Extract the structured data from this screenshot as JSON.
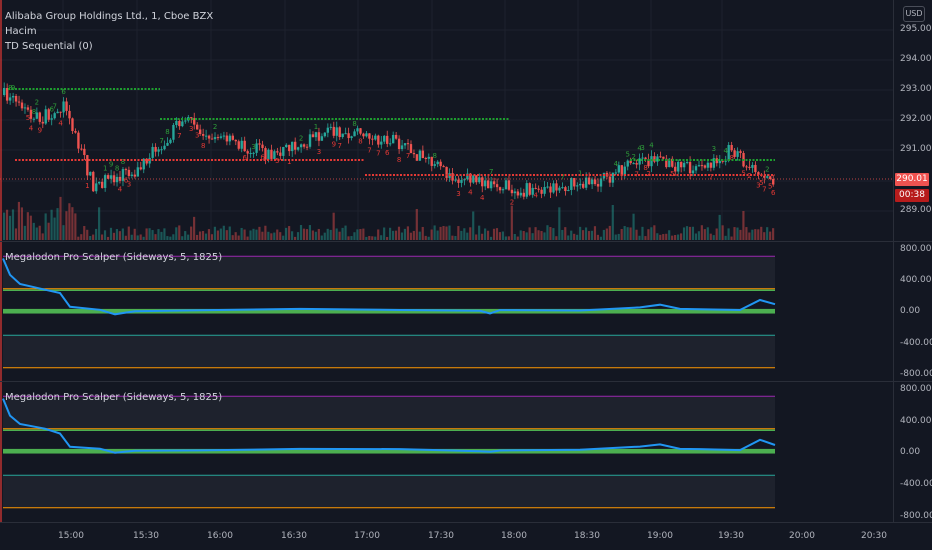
{
  "main": {
    "symbol": "Alibaba Group Holdings Ltd., 1, Cboe BZX",
    "volume_label": "Hacim",
    "indicator_label": "TD Sequential (0)",
    "price_axis": [
      "295.00",
      "294.00",
      "293.00",
      "292.00",
      "291.00",
      "289.00"
    ],
    "last_price": "290.01",
    "countdown": "00:38",
    "currency": "USD",
    "colors": {
      "up": "#26a69a",
      "down": "#ef5350",
      "td_up": "#2e9d3a",
      "td_down": "#e53935",
      "price_badge": "#ef5350",
      "countdown_badge": "#b71c1c"
    }
  },
  "panes": [
    {
      "title": "Megalodon Pro Scalper (Sideways, 5, 1825)",
      "axis": [
        "800.00",
        "400.00",
        "0.00",
        "-400.00",
        "-800.00"
      ]
    },
    {
      "title": "Megalodon Pro Scalper (Sideways, 5, 1825)",
      "axis": [
        "800.00",
        "400.00",
        "0.00",
        "-400.00",
        "-800.00"
      ]
    }
  ],
  "time_axis": [
    "15:00",
    "15:30",
    "16:00",
    "16:30",
    "17:00",
    "17:30",
    "18:00",
    "18:30",
    "19:00",
    "19:30",
    "20:00",
    "20:30"
  ]
}
